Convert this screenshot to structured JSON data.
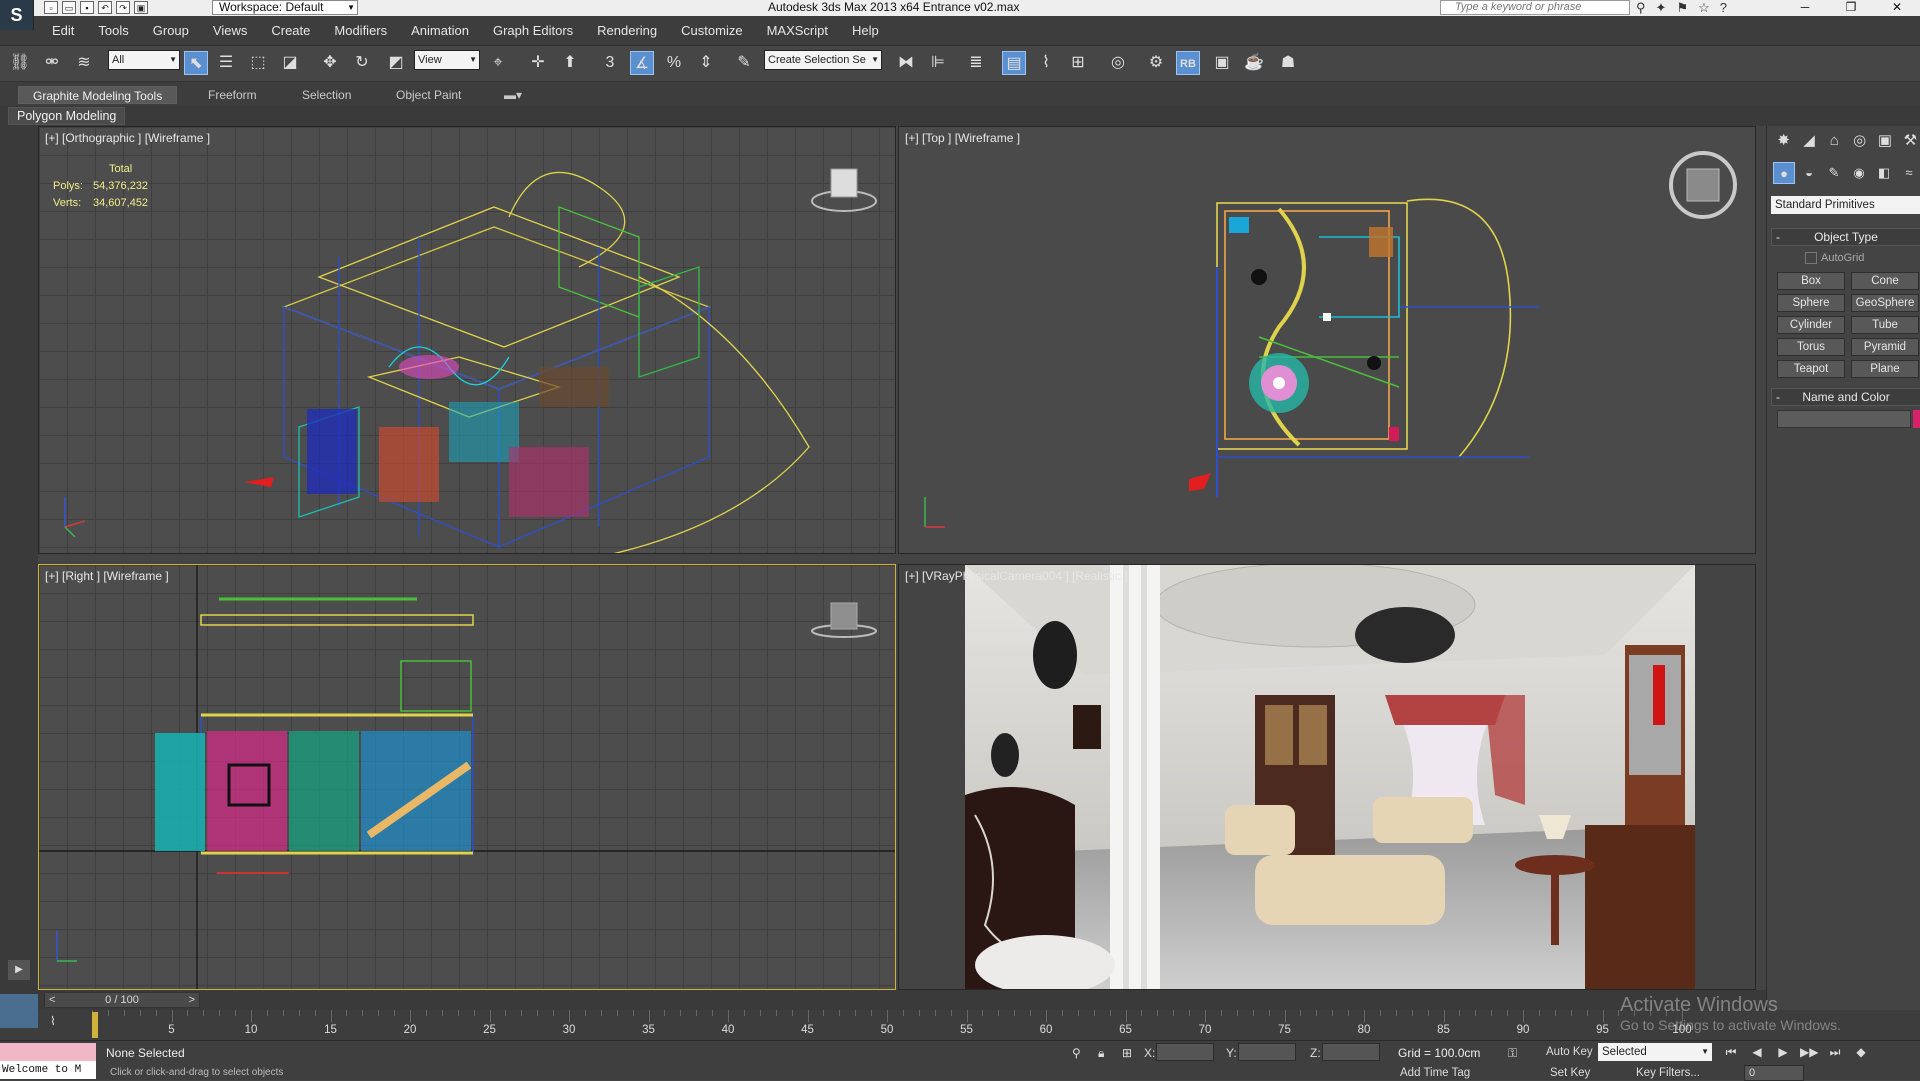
{
  "titlebar": {
    "logo": "S",
    "workspace": "Workspace: Default",
    "app_title": "Autodesk 3ds Max  2013 x64      Entrance v02.max",
    "search_placeholder": "Type a keyword or phrase"
  },
  "menu": [
    "Edit",
    "Tools",
    "Group",
    "Views",
    "Create",
    "Modifiers",
    "Animation",
    "Graph Editors",
    "Rendering",
    "Customize",
    "MAXScript",
    "Help"
  ],
  "toolbar": {
    "selection_filter": "All",
    "ref_coord": "View",
    "snap_label": "3",
    "named_selection": "Create Selection Se",
    "rb_label": "RB"
  },
  "ribbon": {
    "tabs": [
      "Graphite Modeling Tools",
      "Freeform",
      "Selection",
      "Object Paint"
    ],
    "sub_label": "Polygon Modeling"
  },
  "viewports": {
    "ortho_label": "[+] [Orthographic ] [Wireframe ]",
    "top_label": "[+] [Top ] [Wireframe ]",
    "right_label": "[+] [Right ] [Wireframe ]",
    "camera_label": "[+] [VRayPhysicalCamera004 ] [Realistic ]",
    "stats": {
      "header": "Total",
      "polys_label": "Polys:",
      "polys_value": "54,376,232",
      "verts_label": "Verts:",
      "verts_value": "34,607,452"
    }
  },
  "command_panel": {
    "dropdown": "Standard Primitives",
    "object_type": "Object Type",
    "autogrid": "AutoGrid",
    "primitives": [
      "Box",
      "Cone",
      "Sphere",
      "GeoSphere",
      "Cylinder",
      "Tube",
      "Torus",
      "Pyramid",
      "Teapot",
      "Plane"
    ],
    "name_color": "Name and Color"
  },
  "timeline": {
    "frame_counter": "0 / 100",
    "ticks": [
      "5",
      "10",
      "15",
      "20",
      "25",
      "30",
      "35",
      "40",
      "45",
      "50",
      "55",
      "60",
      "65",
      "70",
      "75",
      "80",
      "85",
      "90",
      "95",
      "100"
    ]
  },
  "status": {
    "listener": "Welcome to M",
    "selection": "None Selected",
    "prompt": "Click or click-and-drag to select objects",
    "x_label": "X:",
    "y_label": "Y:",
    "z_label": "Z:",
    "grid": "Grid = 100.0cm",
    "auto_key": "Auto Key",
    "selected": "Selected",
    "set_key": "Set Key",
    "key_filters": "Key Filters...",
    "add_time_tag": "Add Time Tag",
    "frame": "0"
  },
  "watermark": {
    "title": "Activate Windows",
    "subtitle": "Go to Settings to activate Windows."
  },
  "colors": {
    "accent": "#5a8fd0",
    "viewport_bg": "#4d4d4d",
    "stats_text": "#f3ee8a",
    "active_border": "#d0b23a"
  }
}
